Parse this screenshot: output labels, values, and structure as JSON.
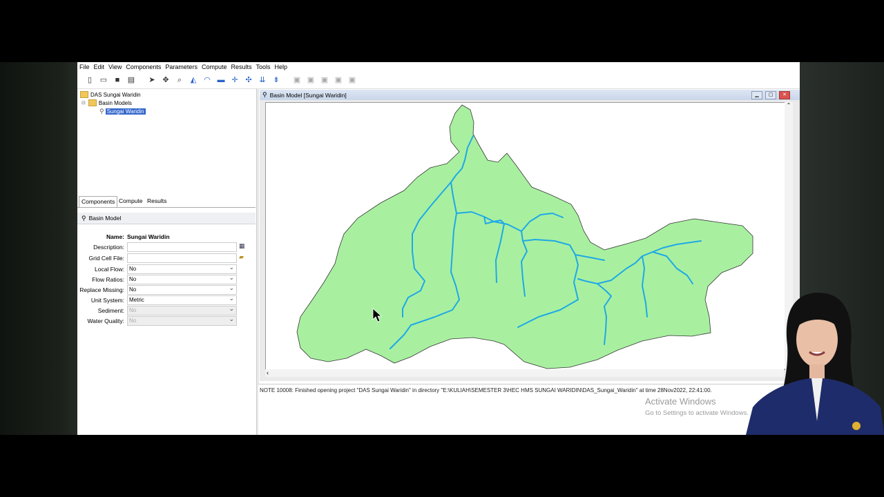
{
  "menubar": [
    "File",
    "Edit",
    "View",
    "Components",
    "Parameters",
    "Compute",
    "Results",
    "Tools",
    "Help"
  ],
  "toolbar_icons": [
    "new-file-icon",
    "open-folder-icon",
    "save-icon",
    "print-icon",
    "arrow-select-icon",
    "pan-icon",
    "zoom-icon",
    "tool-icon",
    "tool-icon",
    "tool-icon",
    "tool-icon",
    "tool-icon",
    "tool-icon",
    "tool-icon",
    "disabled-tool-icon",
    "disabled-tool-icon",
    "disabled-tool-icon",
    "disabled-tool-icon"
  ],
  "tree": {
    "project": "DAS Sungai Waridin",
    "folder": "Basin Models",
    "selected": "Sungai Waridin"
  },
  "tabs": [
    "Components",
    "Compute",
    "Results"
  ],
  "basin_header": "Basin Model",
  "properties": {
    "name_label": "Name:",
    "name_value": "Sungai Waridin",
    "rows": [
      {
        "label": "Description:",
        "value": ""
      },
      {
        "label": "Grid Cell File:",
        "value": ""
      },
      {
        "label": "Local Flow:",
        "value": "No"
      },
      {
        "label": "Flow Ratios:",
        "value": "No"
      },
      {
        "label": "Replace Missing:",
        "value": "No"
      },
      {
        "label": "Unit System:",
        "value": "Metric"
      },
      {
        "label": "Sediment:",
        "value": "No"
      },
      {
        "label": "Water Quality:",
        "value": "No"
      }
    ]
  },
  "basin_window": {
    "title": "Basin Model [Sungai Waridin]",
    "fill_color": "#a8f0a0",
    "river_color": "#1fa8e6"
  },
  "log_message": "NOTE 10008:  Finished opening project \"DAS Sungai Waridin\" in directory \"E:\\KULIAH\\SEMESTER 3\\HEC HMS SUNGAI WARIDIN\\DAS_Sungai_Waridin\" at time 28Nov2022, 22:41:00.",
  "watermark": {
    "line1": "Activate Windows",
    "line2": "Go to Settings to activate Windows."
  }
}
